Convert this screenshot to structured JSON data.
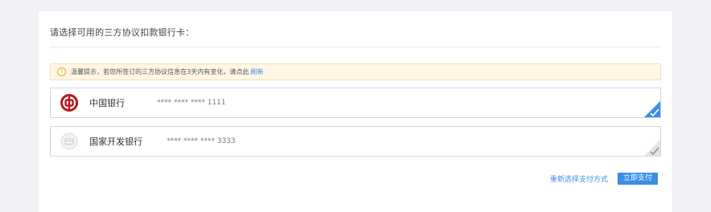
{
  "section": {
    "title": "请选择可用的三方协议扣款银行卡："
  },
  "notice": {
    "icon": "warning-circle-icon",
    "text": "温馨提示，若您所签订的三方协议信息在3天内有变化，请点此",
    "link_label": "刷新",
    "bg_color": "#fff6e5",
    "border_color": "#f7e0ad"
  },
  "cards": [
    {
      "bank_name": "中国银行",
      "card_number": "**** **** **** 1111",
      "logo": "boc-logo-icon",
      "selected": true
    },
    {
      "bank_name": "国家开发银行",
      "card_number": "**** **** **** 3333",
      "logo": "bank-card-icon",
      "selected": false
    }
  ],
  "actions": {
    "reselect_label": "重新选择支付方式",
    "pay_label": "立即支付"
  },
  "colors": {
    "accent": "#3a8ee6",
    "boc_red": "#b51a1f"
  }
}
